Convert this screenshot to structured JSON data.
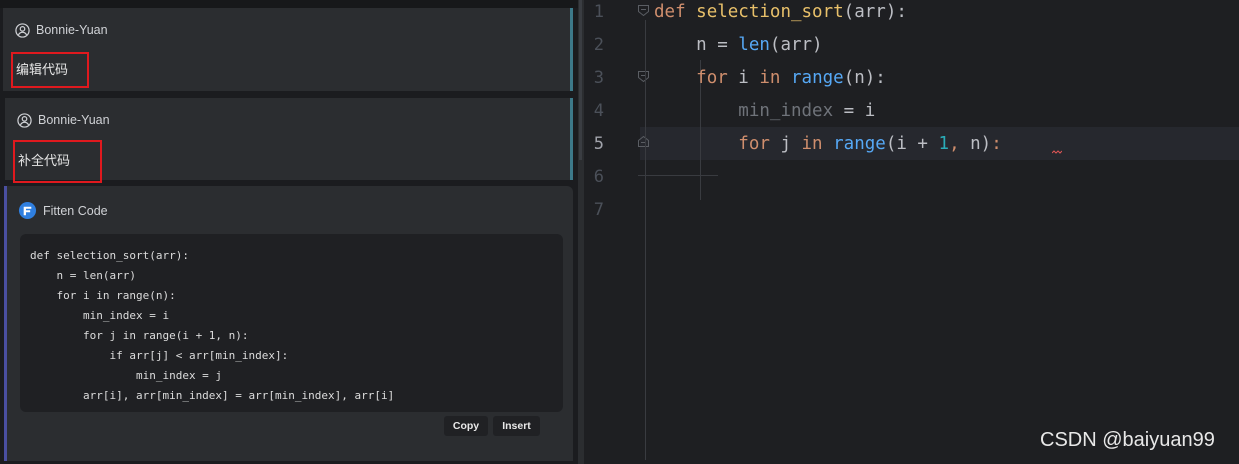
{
  "chat": {
    "messages": [
      {
        "user": "Bonnie-Yuan",
        "text": "编辑代码"
      },
      {
        "user": "Bonnie-Yuan",
        "text": "补全代码"
      }
    ],
    "assistant": {
      "name": "Fitten Code",
      "code": "def selection_sort(arr):\n    n = len(arr)\n    for i in range(n):\n        min_index = i\n        for j in range(i + 1, n):\n            if arr[j] < arr[min_index]:\n                min_index = j\n        arr[i], arr[min_index] = arr[min_index], arr[i]",
      "copy_label": "Copy",
      "insert_label": "Insert"
    }
  },
  "editor": {
    "line_numbers": [
      "1",
      "2",
      "3",
      "4",
      "5",
      "6",
      "7"
    ],
    "active_line": "5",
    "lines": [
      "def selection_sort(arr):",
      "    n = len(arr)",
      "    for i in range(n):",
      "        min_index = i",
      "        for j in range(i + 1, n):",
      "",
      ""
    ]
  },
  "watermark": "CSDN @baiyuan99"
}
